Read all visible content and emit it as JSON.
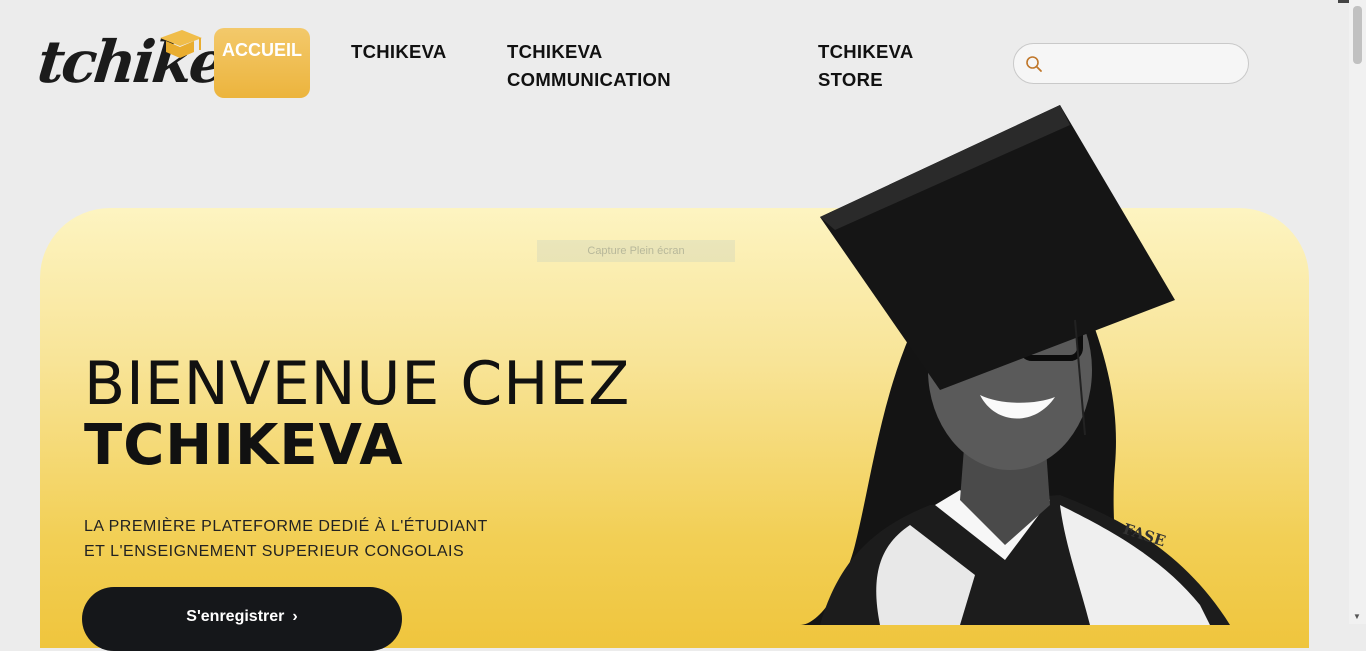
{
  "brand": {
    "logo_text": "tchikeva"
  },
  "nav": {
    "accueil": "ACCUEIL",
    "items": [
      {
        "label_line1": "TCHIKEVA",
        "label_line2": ""
      },
      {
        "label_line1": "TCHIKEVA",
        "label_line2": "COMMUNICATION"
      },
      {
        "label_line1": "TCHIKEVA",
        "label_line2": "STORE"
      }
    ]
  },
  "search": {
    "value": "",
    "placeholder": ""
  },
  "overlay": {
    "capture_label": "Capture Plein écran"
  },
  "hero": {
    "title_line1": "BIENVENUE CHEZ",
    "title_line2": "TCHIKEVA",
    "subtitle_line1": "LA PREMIÈRE PLATEFORME DEDIÉ À L'ÉTUDIANT",
    "subtitle_line2": "ET L'ENSEIGNEMENT SUPERIEUR CONGOLAIS",
    "cta_label": "S'enregistrer",
    "sash_text": "FASE"
  },
  "icons": {
    "search": "search-icon",
    "cap": "graduation-cap-icon",
    "chevron": "chevron-right-icon"
  },
  "colors": {
    "accent": "#ecb43d",
    "hero_top": "#fdf4c1",
    "hero_bottom": "#efc53d",
    "cta": "#15171a",
    "background": "#ececec"
  }
}
